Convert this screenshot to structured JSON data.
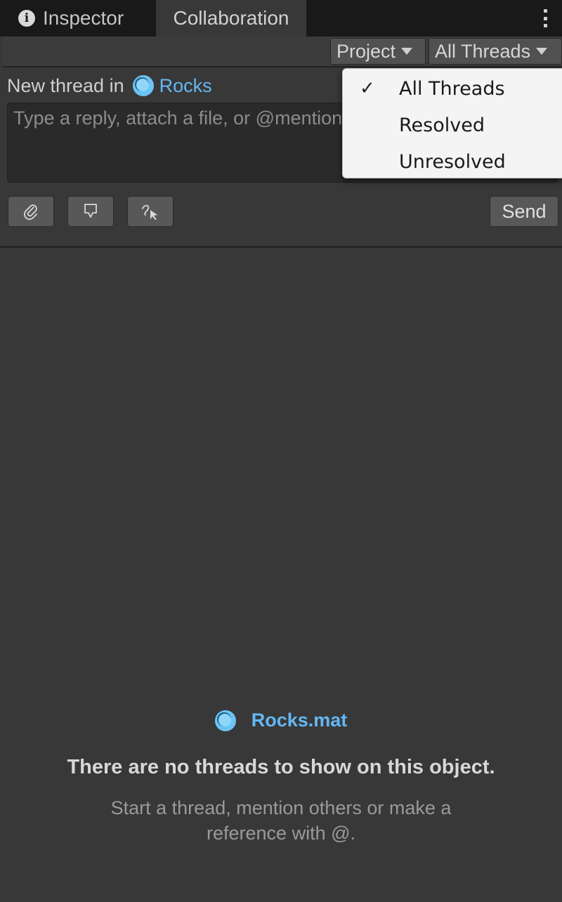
{
  "tabs": [
    {
      "label": "Inspector",
      "icon": "info-icon"
    },
    {
      "label": "Collaboration"
    }
  ],
  "toolbar": {
    "project_label": "Project",
    "filter_label": "All Threads"
  },
  "compose": {
    "new_thread_prefix": "New thread in",
    "target_name": "Rocks",
    "placeholder": "Type a reply, attach a file, or @mention",
    "send_label": "Send",
    "tools": [
      "attach-icon",
      "pin-icon",
      "draw-icon"
    ]
  },
  "empty_state": {
    "object_name": "Rocks.mat",
    "heading": "There are no threads to show on this object.",
    "subtext": "Start a thread, mention others or make a reference with @."
  },
  "filter_menu": {
    "items": [
      {
        "label": "All Threads",
        "checked": true,
        "check_glyph": "✓"
      },
      {
        "label": "Resolved",
        "checked": false
      },
      {
        "label": "Unresolved",
        "checked": false
      }
    ]
  },
  "colors": {
    "background": "#383838",
    "tabbar": "#191919",
    "link": "#64b7f3",
    "menu_bg": "#f4f4f4"
  }
}
